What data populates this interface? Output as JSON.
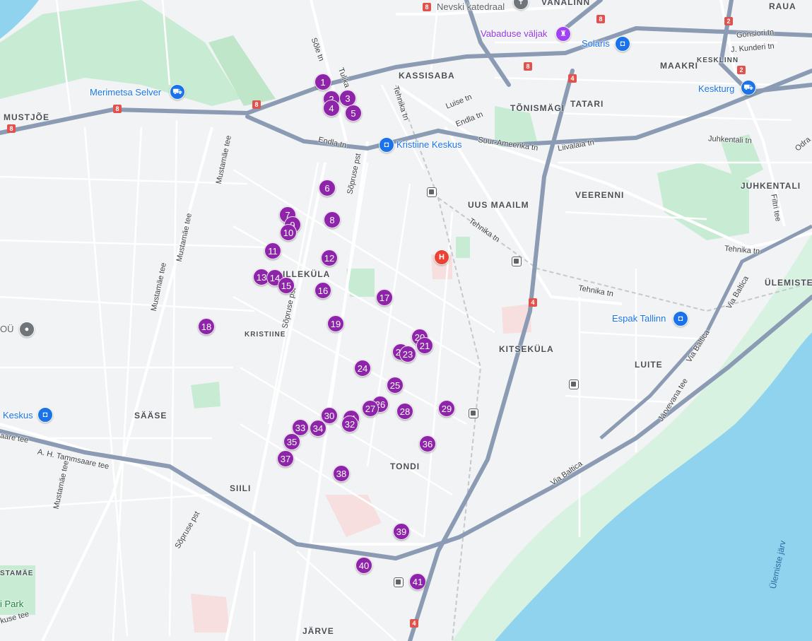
{
  "map": {
    "colors": {
      "land": "#f1f3f4",
      "water": "#8fd3ee",
      "park": "#c8ecd3",
      "highway": "#8a9bb3",
      "marker": "#8e24aa"
    },
    "districts": [
      "VANALINN",
      "RAUA",
      "KASSISABA",
      "MAAKRI",
      "KESKLINN",
      "TÕNISMÄGI",
      "TATARI",
      "MUSTJÕE",
      "UUS MAAILM",
      "VEERENNI",
      "JUHKENTALI",
      "ÜLEMISTE",
      "ILLEKÜLA",
      "KRISTIINE",
      "KITSEKÜLA",
      "LUITE",
      "SÄÄSE",
      "TONDI",
      "SIILI",
      "JÄRVE",
      "STAMÄE"
    ],
    "streets": [
      "Sõle tn",
      "Tulika",
      "Tehnika tn",
      "Luise tn",
      "Endla tn",
      "Endla tn",
      "Suur-Ameerika tn",
      "Liivalaia tn",
      "Gonsiori tn",
      "J. Kunderi tn",
      "Juhkentali tn",
      "Filtri tee",
      "Odra",
      "Tehnika tn",
      "Tehnika tn",
      "Tehnika tn",
      "Sõpruse pst",
      "Sõpruse pst",
      "Mustamäe tee",
      "Mustamäe tee",
      "Mustamäe tee",
      "Mustamäe tee",
      "A. H. Tammsaare tee",
      "aare tee",
      "Sõpruse pst",
      "kuse tee",
      "Järvevana tee",
      "Via Baltica",
      "Via Baltica",
      "Via Baltica"
    ],
    "lake_label": "Ülemiste järv",
    "pois": [
      {
        "label": "Nevski katedraal",
        "icon": "church-icon"
      },
      {
        "label": "Vabaduse väljak",
        "icon": "monument-icon"
      },
      {
        "label": "Solaris",
        "icon": "shopping-bag-icon"
      },
      {
        "label": "Merimetsa Selver",
        "icon": "shopping-cart-icon"
      },
      {
        "label": "Keskturg",
        "icon": "shopping-cart-icon"
      },
      {
        "label": "Kristiine Keskus",
        "icon": "shopping-bag-icon"
      },
      {
        "label": "Espak Tallinn",
        "icon": "shopping-bag-icon"
      },
      {
        "label": "Keskus",
        "icon": "shopping-bag-icon"
      },
      {
        "label": "OÜ",
        "icon": "place-icon"
      },
      {
        "label": "i Park",
        "icon": "park-icon"
      },
      {
        "label": "H",
        "icon": "hospital-icon"
      }
    ],
    "route_shields": [
      "8",
      "8",
      "8",
      "8",
      "8",
      "4",
      "4",
      "4",
      "2",
      "2"
    ],
    "markers": [
      "1",
      "2",
      "3",
      "4",
      "5",
      "6",
      "7",
      "8",
      "9",
      "10",
      "11",
      "12",
      "13",
      "14",
      "15",
      "16",
      "17",
      "18",
      "19",
      "20",
      "21",
      "22",
      "23",
      "24",
      "25",
      "26",
      "27",
      "28",
      "29",
      "30",
      "31",
      "32",
      "33",
      "34",
      "35",
      "36",
      "37",
      "38",
      "39",
      "40",
      "41"
    ]
  }
}
